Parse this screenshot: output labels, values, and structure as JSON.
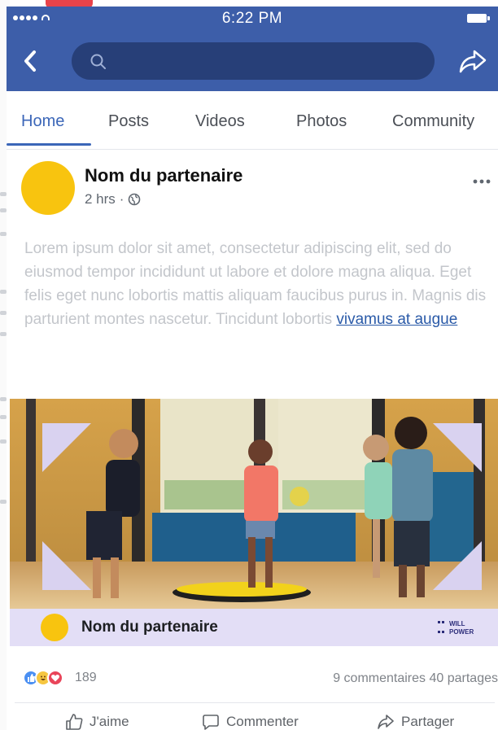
{
  "status_bar": {
    "time": "6:22 PM"
  },
  "tabs": [
    {
      "label": "Home",
      "active": true
    },
    {
      "label": "Posts",
      "active": false
    },
    {
      "label": "Videos",
      "active": false
    },
    {
      "label": "Photos",
      "active": false
    },
    {
      "label": "Community",
      "active": false
    }
  ],
  "post": {
    "author": "Nom du partenaire",
    "time": "2 hrs",
    "separator": "·",
    "body": "Lorem ipsum dolor sit amet, consectetur adipiscing elit, sed do eiusmod tempor incididunt ut labore et dolore magna aliqua. Eget felis eget nunc lobortis mattis aliquam faucibus purus in. Magnis dis parturient montes nascetur. Tincidunt lobortis ",
    "link_text": "vivamus at augue",
    "image_footer_name": "Nom du partenaire",
    "logo_text_1": "WILL",
    "logo_text_2": "POWER"
  },
  "engagement": {
    "reaction_count": "189",
    "comments": "9 commentaires",
    "shares": "40 partages"
  },
  "actions": {
    "like": "J'aime",
    "comment": "Commenter",
    "share": "Partager"
  },
  "colors": {
    "header": "#3d5ea9",
    "accent": "#3b66b8",
    "avatar": "#f8c40f",
    "footer_strip": "#e3def6"
  },
  "icons": [
    "back-icon",
    "search-icon",
    "share-icon",
    "globe-icon",
    "more-icon",
    "like-icon",
    "comment-icon",
    "share-arrow-icon"
  ]
}
